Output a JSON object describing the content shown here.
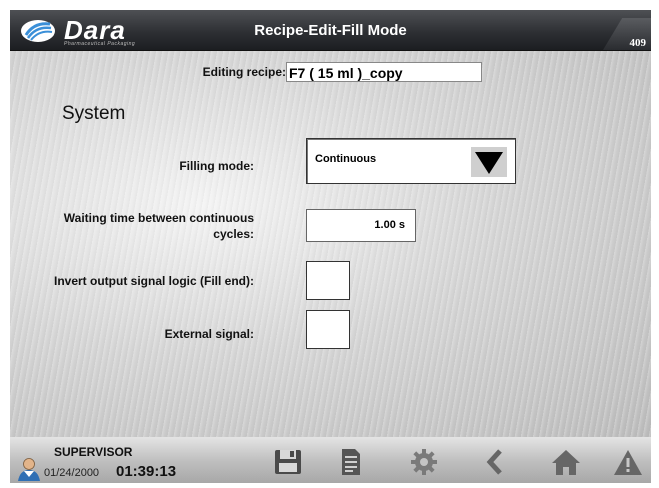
{
  "header": {
    "logo_text": "Dara",
    "logo_sub": "Pharmaceutical Packaging",
    "title": "Recipe-Edit-Fill Mode",
    "screen_number": "409"
  },
  "recipe": {
    "editing_label": "Editing recipe:",
    "name": "F7 ( 15 ml )_copy"
  },
  "section": {
    "title": "System"
  },
  "fields": {
    "filling_mode": {
      "label": "Filling mode:",
      "value": "Continuous"
    },
    "waiting_time": {
      "label": "Waiting time between continuous cycles:",
      "value": "1.00 s"
    },
    "invert_output": {
      "label": "Invert output signal logic (Fill end):",
      "checked": false
    },
    "external_signal": {
      "label": "External signal:",
      "checked": false
    }
  },
  "footer": {
    "user_role": "SUPERVISOR",
    "date": "01/24/2000",
    "time": "01:39:13",
    "buttons": [
      {
        "icon": "save-icon"
      },
      {
        "icon": "document-icon"
      },
      {
        "icon": "gear-icon"
      },
      {
        "icon": "back-arrow-icon"
      },
      {
        "icon": "home-icon"
      },
      {
        "icon": "alarm-warning-icon"
      }
    ]
  },
  "colors": {
    "header_bg": "#2e3034",
    "footer_icon": "#555555",
    "logo_accent": "#3a8fd8"
  }
}
